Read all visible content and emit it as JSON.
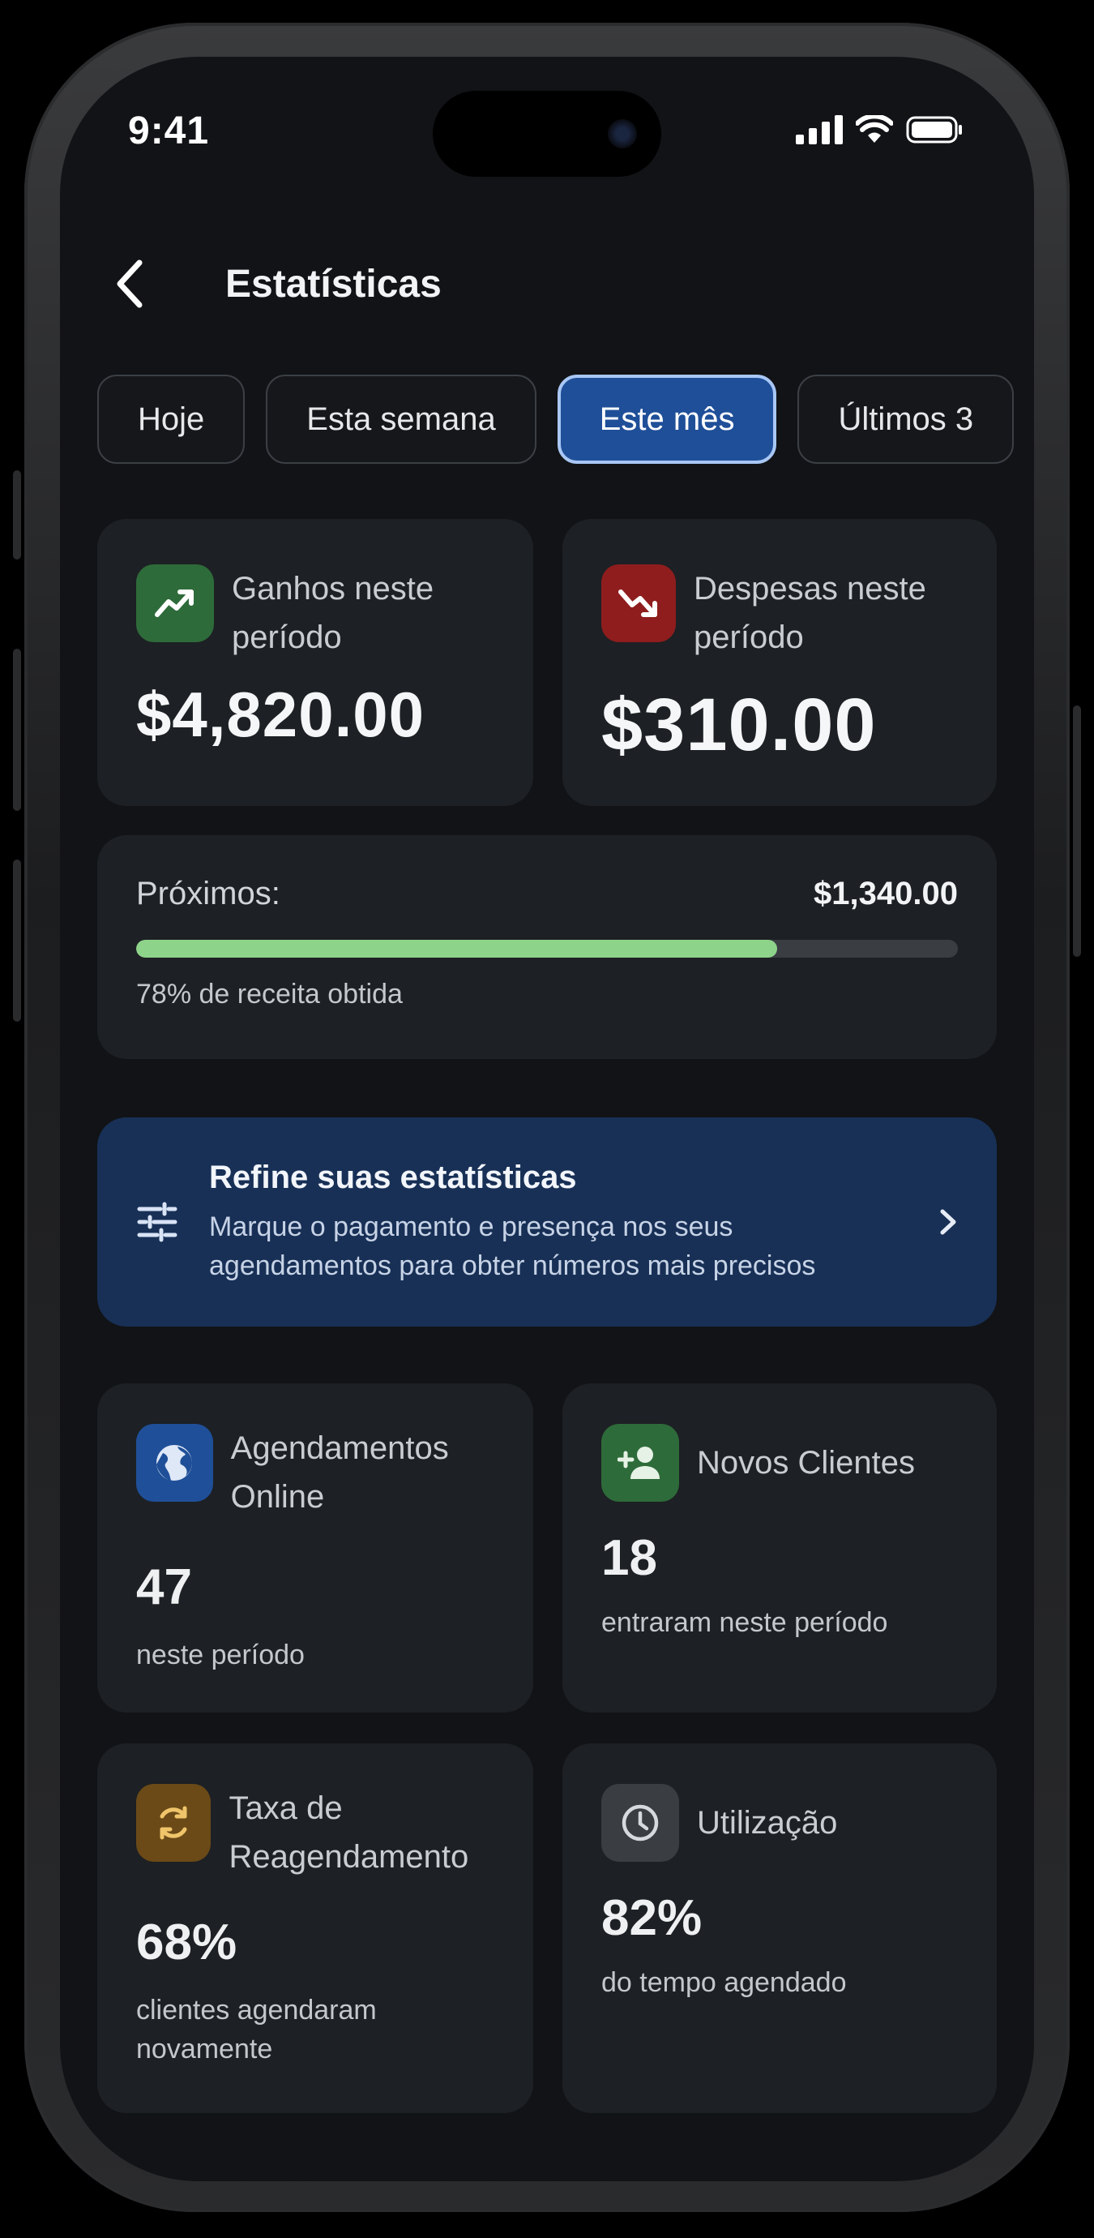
{
  "status": {
    "time": "9:41"
  },
  "header": {
    "title": "Estatísticas"
  },
  "tabs": [
    {
      "label": "Hoje",
      "active": false
    },
    {
      "label": "Esta semana",
      "active": false
    },
    {
      "label": "Este mês",
      "active": true
    },
    {
      "label": "Últimos 3",
      "active": false
    }
  ],
  "earnings": {
    "label": "Ganhos neste período",
    "value": "$4,820.00",
    "icon": "trending-up-icon",
    "color": "#2e6b3a"
  },
  "expenses": {
    "label": "Despesas neste período",
    "value": "$310.00",
    "icon": "trending-down-icon",
    "color": "#8f1d1d"
  },
  "upcoming": {
    "label": "Próximos:",
    "value": "$1,340.00",
    "progress": 78,
    "caption": "78% de receita obtida"
  },
  "banner": {
    "title": "Refine suas estatísticas",
    "text_line1": "Marque o pagamento e presença nos seus",
    "text_line2": "agendamentos para obter números mais precisos"
  },
  "stats": {
    "online": {
      "label": "Agendamentos Online",
      "value": "47",
      "sub": "neste período",
      "color": "#1f4f98"
    },
    "clients": {
      "label": "Novos Clientes",
      "value": "18",
      "sub": "entraram neste período",
      "color": "#2e6b3a"
    },
    "rebook": {
      "label": "Taxa de Reagendamento",
      "value": "68%",
      "sub": "clientes agendaram novamente",
      "color": "#6b4a17"
    },
    "util": {
      "label": "Utilização",
      "value": "82%",
      "sub": "do tempo agendado",
      "color": "#3a3d42"
    }
  }
}
